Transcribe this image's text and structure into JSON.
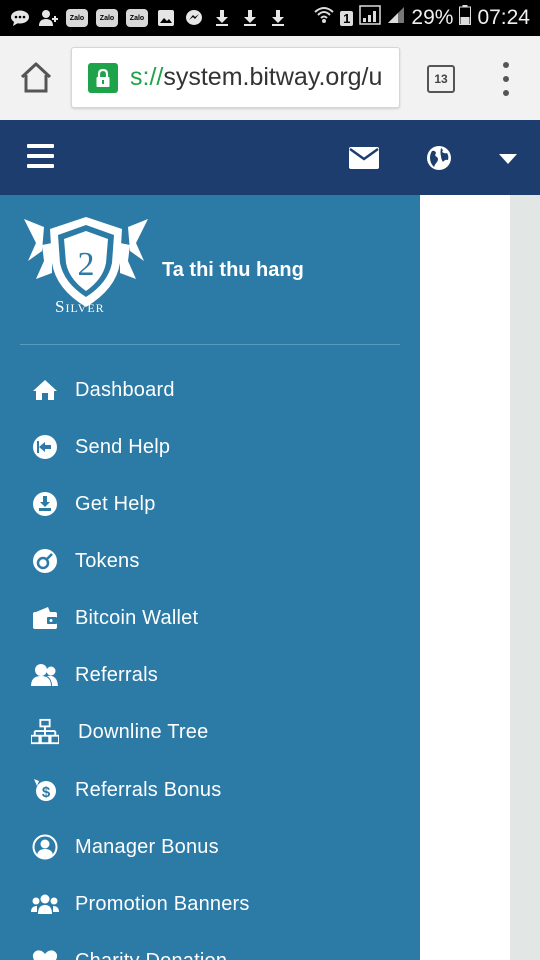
{
  "status_bar": {
    "battery_percent": "29%",
    "time": "07:24",
    "sim_badge": "1",
    "zalo_label": "Zalo",
    "icons": [
      "chat-bubble-icon",
      "add-contact-icon",
      "zalo-icon",
      "zalo-icon",
      "zalo-icon",
      "image-icon",
      "messenger-icon",
      "download-icon",
      "download-icon",
      "download-icon",
      "wifi-icon",
      "signal-icon",
      "battery-icon"
    ]
  },
  "browser": {
    "url_scheme_fragment": "s://",
    "url_text": "system.bitway.org/u",
    "tab_count": "13"
  },
  "topnav": {
    "icons": [
      "menu-icon",
      "mail-icon",
      "globe-icon",
      "caret-down-icon"
    ]
  },
  "sidebar": {
    "rank": "Silver",
    "rank_number": "2",
    "user_name": "Ta thi thu hang",
    "items": [
      {
        "label": "Dashboard",
        "icon": "home-icon"
      },
      {
        "label": "Send Help",
        "icon": "send-out-icon"
      },
      {
        "label": "Get Help",
        "icon": "download-circle-icon"
      },
      {
        "label": "Tokens",
        "icon": "token-icon"
      },
      {
        "label": "Bitcoin Wallet",
        "icon": "wallet-icon"
      },
      {
        "label": "Referrals",
        "icon": "users-icon"
      },
      {
        "label": "Downline Tree",
        "icon": "sitemap-icon"
      },
      {
        "label": "Referrals Bonus",
        "icon": "bonus-icon"
      },
      {
        "label": "Manager Bonus",
        "icon": "user-circle-icon"
      },
      {
        "label": "Promotion Banners",
        "icon": "group-icon"
      },
      {
        "label": "Charity Donation",
        "icon": "heart-icon"
      }
    ]
  },
  "colors": {
    "nav_bar": "#1c3d6e",
    "sidebar": "#2c7aa6",
    "secure_green": "#1fa34a"
  }
}
